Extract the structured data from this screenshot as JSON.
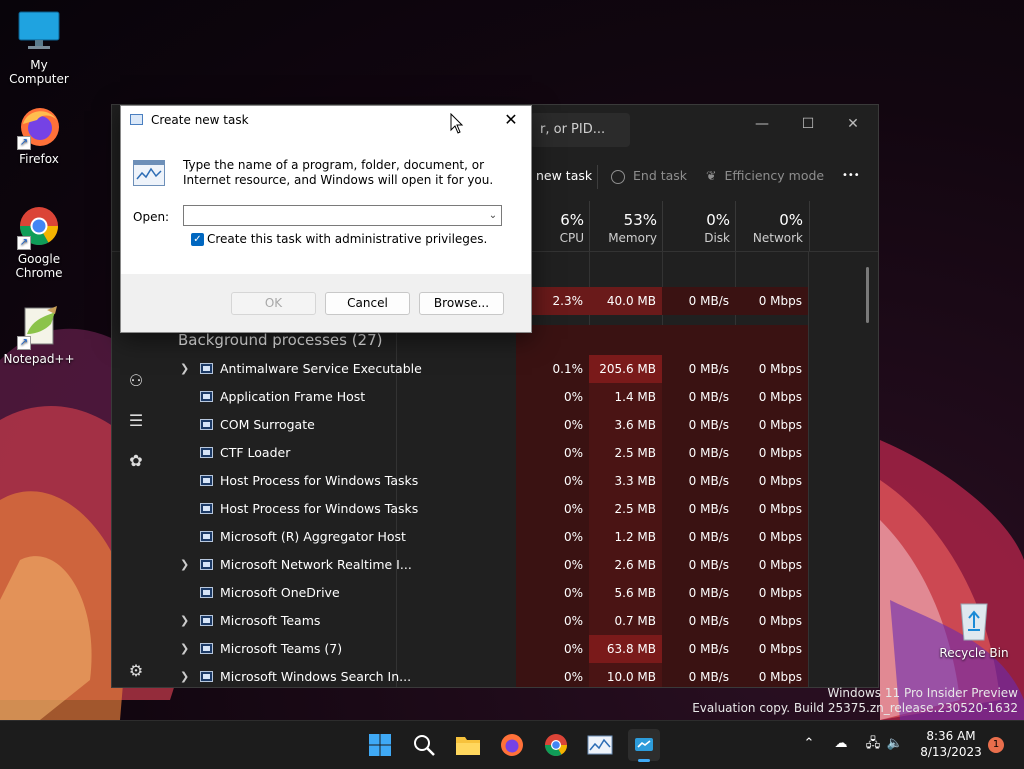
{
  "desktop": {
    "icons": [
      {
        "label": "My Computer"
      },
      {
        "label": "Firefox"
      },
      {
        "label": "Google Chrome"
      },
      {
        "label": "Notepad++"
      },
      {
        "label": "Recycle Bin"
      }
    ]
  },
  "task_manager": {
    "search_placeholder": "r, or PID...",
    "toolbar": {
      "new_task": "new task",
      "end_task": "End task",
      "efficiency_mode": "Efficiency mode",
      "more": "•••"
    },
    "columns": [
      {
        "pct": "6%",
        "label": "CPU"
      },
      {
        "pct": "53%",
        "label": "Memory"
      },
      {
        "pct": "0%",
        "label": "Disk"
      },
      {
        "pct": "0%",
        "label": "Network"
      }
    ],
    "top_row": {
      "cpu": "2.3%",
      "mem": "40.0 MB",
      "disk": "0 MB/s",
      "net": "0 Mbps"
    },
    "group_title": "Background processes (27)",
    "processes": [
      {
        "name": "Antimalware Service Executable",
        "cpu": "0.1%",
        "mem": "205.6 MB",
        "disk": "0 MB/s",
        "net": "0 Mbps"
      },
      {
        "name": "Application Frame Host",
        "cpu": "0%",
        "mem": "1.4 MB",
        "disk": "0 MB/s",
        "net": "0 Mbps"
      },
      {
        "name": "COM Surrogate",
        "cpu": "0%",
        "mem": "3.6 MB",
        "disk": "0 MB/s",
        "net": "0 Mbps"
      },
      {
        "name": "CTF Loader",
        "cpu": "0%",
        "mem": "2.5 MB",
        "disk": "0 MB/s",
        "net": "0 Mbps"
      },
      {
        "name": "Host Process for Windows Tasks",
        "cpu": "0%",
        "mem": "3.3 MB",
        "disk": "0 MB/s",
        "net": "0 Mbps"
      },
      {
        "name": "Host Process for Windows Tasks",
        "cpu": "0%",
        "mem": "2.5 MB",
        "disk": "0 MB/s",
        "net": "0 Mbps"
      },
      {
        "name": "Microsoft (R) Aggregator Host",
        "cpu": "0%",
        "mem": "1.2 MB",
        "disk": "0 MB/s",
        "net": "0 Mbps"
      },
      {
        "name": "Microsoft Network Realtime I...",
        "cpu": "0%",
        "mem": "2.6 MB",
        "disk": "0 MB/s",
        "net": "0 Mbps"
      },
      {
        "name": "Microsoft OneDrive",
        "cpu": "0%",
        "mem": "5.6 MB",
        "disk": "0 MB/s",
        "net": "0 Mbps"
      },
      {
        "name": "Microsoft Teams",
        "cpu": "0%",
        "mem": "0.7 MB",
        "disk": "0 MB/s",
        "net": "0 Mbps"
      },
      {
        "name": "Microsoft Teams (7)",
        "cpu": "0%",
        "mem": "63.8 MB",
        "disk": "0 MB/s",
        "net": "0 Mbps"
      },
      {
        "name": "Microsoft Windows Search In...",
        "cpu": "0%",
        "mem": "10.0 MB",
        "disk": "0 MB/s",
        "net": "0 Mbps"
      }
    ]
  },
  "dialog": {
    "title": "Create new task",
    "description": "Type the name of a program, folder, document, or Internet resource, and Windows will open it for you.",
    "open_label": "Open:",
    "open_value": "",
    "admin_label": "Create this task with administrative privileges.",
    "admin_checked": true,
    "ok": "OK",
    "cancel": "Cancel",
    "browse": "Browse..."
  },
  "watermark": {
    "line1": "Windows 11 Pro Insider Preview",
    "line2": "Evaluation copy. Build 25375.zn_release.230520-1632"
  },
  "taskbar": {
    "time": "8:36 AM",
    "date": "8/13/2023",
    "notifications": "1"
  },
  "colors": {
    "accent": "#0067c0",
    "heat_high": "#8a1a1a",
    "heat_mid": "#5e1616",
    "heat_low": "#3a1212"
  }
}
